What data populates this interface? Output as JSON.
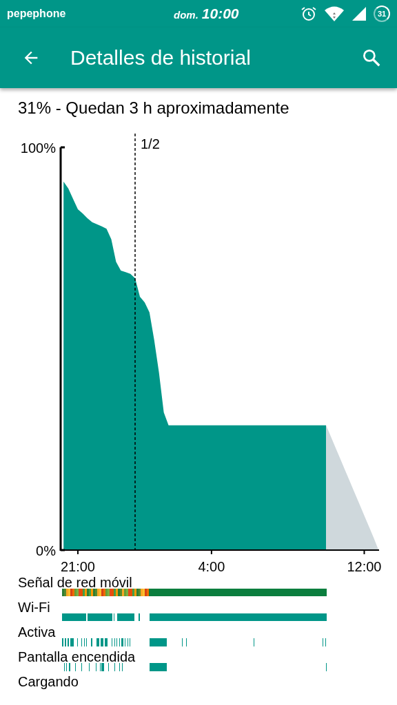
{
  "status_bar": {
    "carrier": "pepephone",
    "day": "dom.",
    "time": "10:00",
    "battery": "31"
  },
  "app_bar": {
    "title": "Detalles de historial"
  },
  "summary": "31% - Quedan 3 h aproximadamente",
  "chart_data": {
    "type": "area",
    "categories": [
      null,
      null,
      null,
      "21:00",
      null,
      null,
      null,
      null,
      null,
      null,
      null,
      null,
      null,
      null,
      null,
      null,
      null,
      null,
      null,
      null,
      null,
      null,
      null,
      null,
      null,
      null,
      null,
      null,
      null,
      null,
      null,
      "4:00",
      null,
      null,
      null,
      null,
      null,
      null,
      null,
      null,
      null,
      null,
      null,
      null,
      null,
      null,
      null,
      null,
      null,
      null,
      null,
      null,
      null,
      null,
      null,
      null,
      null,
      null,
      null,
      null,
      null,
      null,
      null,
      "12:00",
      null,
      null,
      null
    ],
    "series": [
      {
        "color": "#009688",
        "values": [
          91.5,
          89.8,
          87.2,
          84.6,
          83.6,
          82.4,
          81.4,
          80.9,
          80.4,
          79.8,
          77.2,
          71.6,
          69.4,
          69.0,
          68.6,
          67.5,
          62.9,
          61.5,
          59.0,
          52.1,
          44.0,
          34.2,
          31,
          31,
          31,
          31,
          31,
          31,
          31,
          31,
          31,
          31,
          31,
          31,
          31,
          31,
          31,
          31,
          31,
          31,
          31,
          31,
          31,
          31,
          31,
          31,
          31,
          31,
          31,
          31,
          31,
          31,
          31,
          31,
          31,
          31,
          null,
          null,
          null,
          null,
          null,
          null,
          null,
          null,
          null,
          null,
          null
        ]
      },
      {
        "color": "#cfd8dc",
        "values": [
          null,
          null,
          null,
          null,
          null,
          null,
          null,
          null,
          null,
          null,
          null,
          null,
          null,
          null,
          null,
          null,
          null,
          null,
          null,
          null,
          null,
          null,
          null,
          null,
          null,
          null,
          null,
          null,
          null,
          null,
          null,
          null,
          null,
          null,
          null,
          null,
          null,
          null,
          null,
          null,
          null,
          null,
          null,
          null,
          null,
          null,
          null,
          null,
          null,
          null,
          null,
          null,
          null,
          null,
          null,
          31,
          28.2,
          25.4,
          22.6,
          19.8,
          17,
          14.2,
          11.4,
          8.6,
          5.8,
          3,
          0
        ]
      }
    ],
    "ylim": [
      0,
      100
    ],
    "yticks": [
      {
        "value": 0,
        "label": "0%"
      },
      {
        "value": 100,
        "label": "100%"
      }
    ],
    "annotations": [
      "1/2"
    ]
  },
  "timelines": [
    {
      "kind": "signal",
      "label": "Señal de red móvil"
    },
    {
      "kind": "wifi",
      "label": "Wi-Fi"
    },
    {
      "kind": "active",
      "label": "Activa"
    },
    {
      "kind": "screen",
      "label": "Pantalla encendida"
    },
    {
      "kind": "charging",
      "label": "Cargando"
    }
  ]
}
